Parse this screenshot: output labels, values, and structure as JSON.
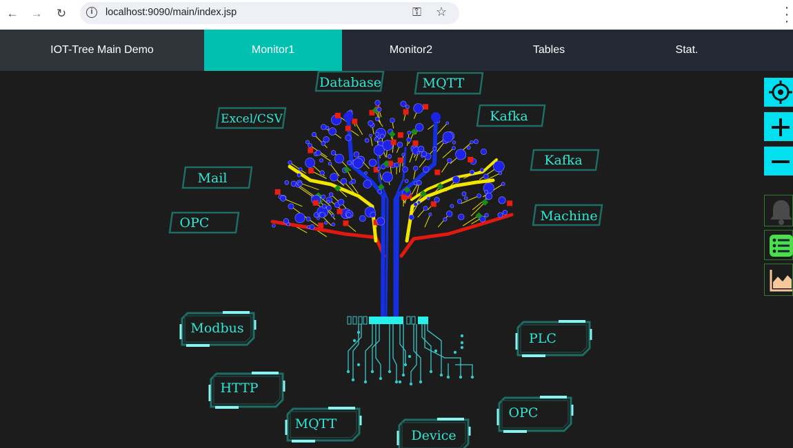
{
  "browser": {
    "url": "localhost:9090/main/index.jsp",
    "back_icon": "arrow-left-icon",
    "forward_icon": "arrow-right-icon",
    "reload_icon": "reload-icon",
    "info_icon": "info-icon",
    "key_icon": "key-icon",
    "star_icon": "star-icon",
    "menu_icon": "kebab-menu-icon"
  },
  "nav": {
    "brand": "IOT-Tree Main Demo",
    "tabs": [
      {
        "label": "Monitor1",
        "active": true
      },
      {
        "label": "Monitor2",
        "active": false
      },
      {
        "label": "Tables",
        "active": false
      },
      {
        "label": "Stat.",
        "active": false
      }
    ]
  },
  "tree_labels": {
    "database": "Database",
    "mqtt_top": "MQTT",
    "excel": "Excel/CSV",
    "kafka1": "Kafka",
    "kafka2": "Kafka",
    "mail": "Mail",
    "opc_left": "OPC",
    "machine": "Machine"
  },
  "root_labels": {
    "modbus": "Modbus",
    "plc": "PLC",
    "http": "HTTP",
    "opc_right": "OPC",
    "mqtt_bottom": "MQTT",
    "device": "Device"
  },
  "tools": [
    {
      "name": "locate-icon"
    },
    {
      "name": "zoom-in-icon"
    },
    {
      "name": "zoom-out-icon"
    },
    {
      "name": "bell-icon"
    },
    {
      "name": "list-icon"
    },
    {
      "name": "area-chart-icon"
    }
  ],
  "colors": {
    "accent": "#00c1b0",
    "label": "#2ee8d4",
    "tool_cyan": "#00e0f0",
    "trunk_blue": "#1530e0",
    "branch_yellow": "#f2e600",
    "branch_red": "#e01a10",
    "leaf_blue": "#1e22e6",
    "leaf_red": "#e81e10",
    "leaf_green": "#1a8a1a",
    "circuit": "#38c8c8"
  }
}
